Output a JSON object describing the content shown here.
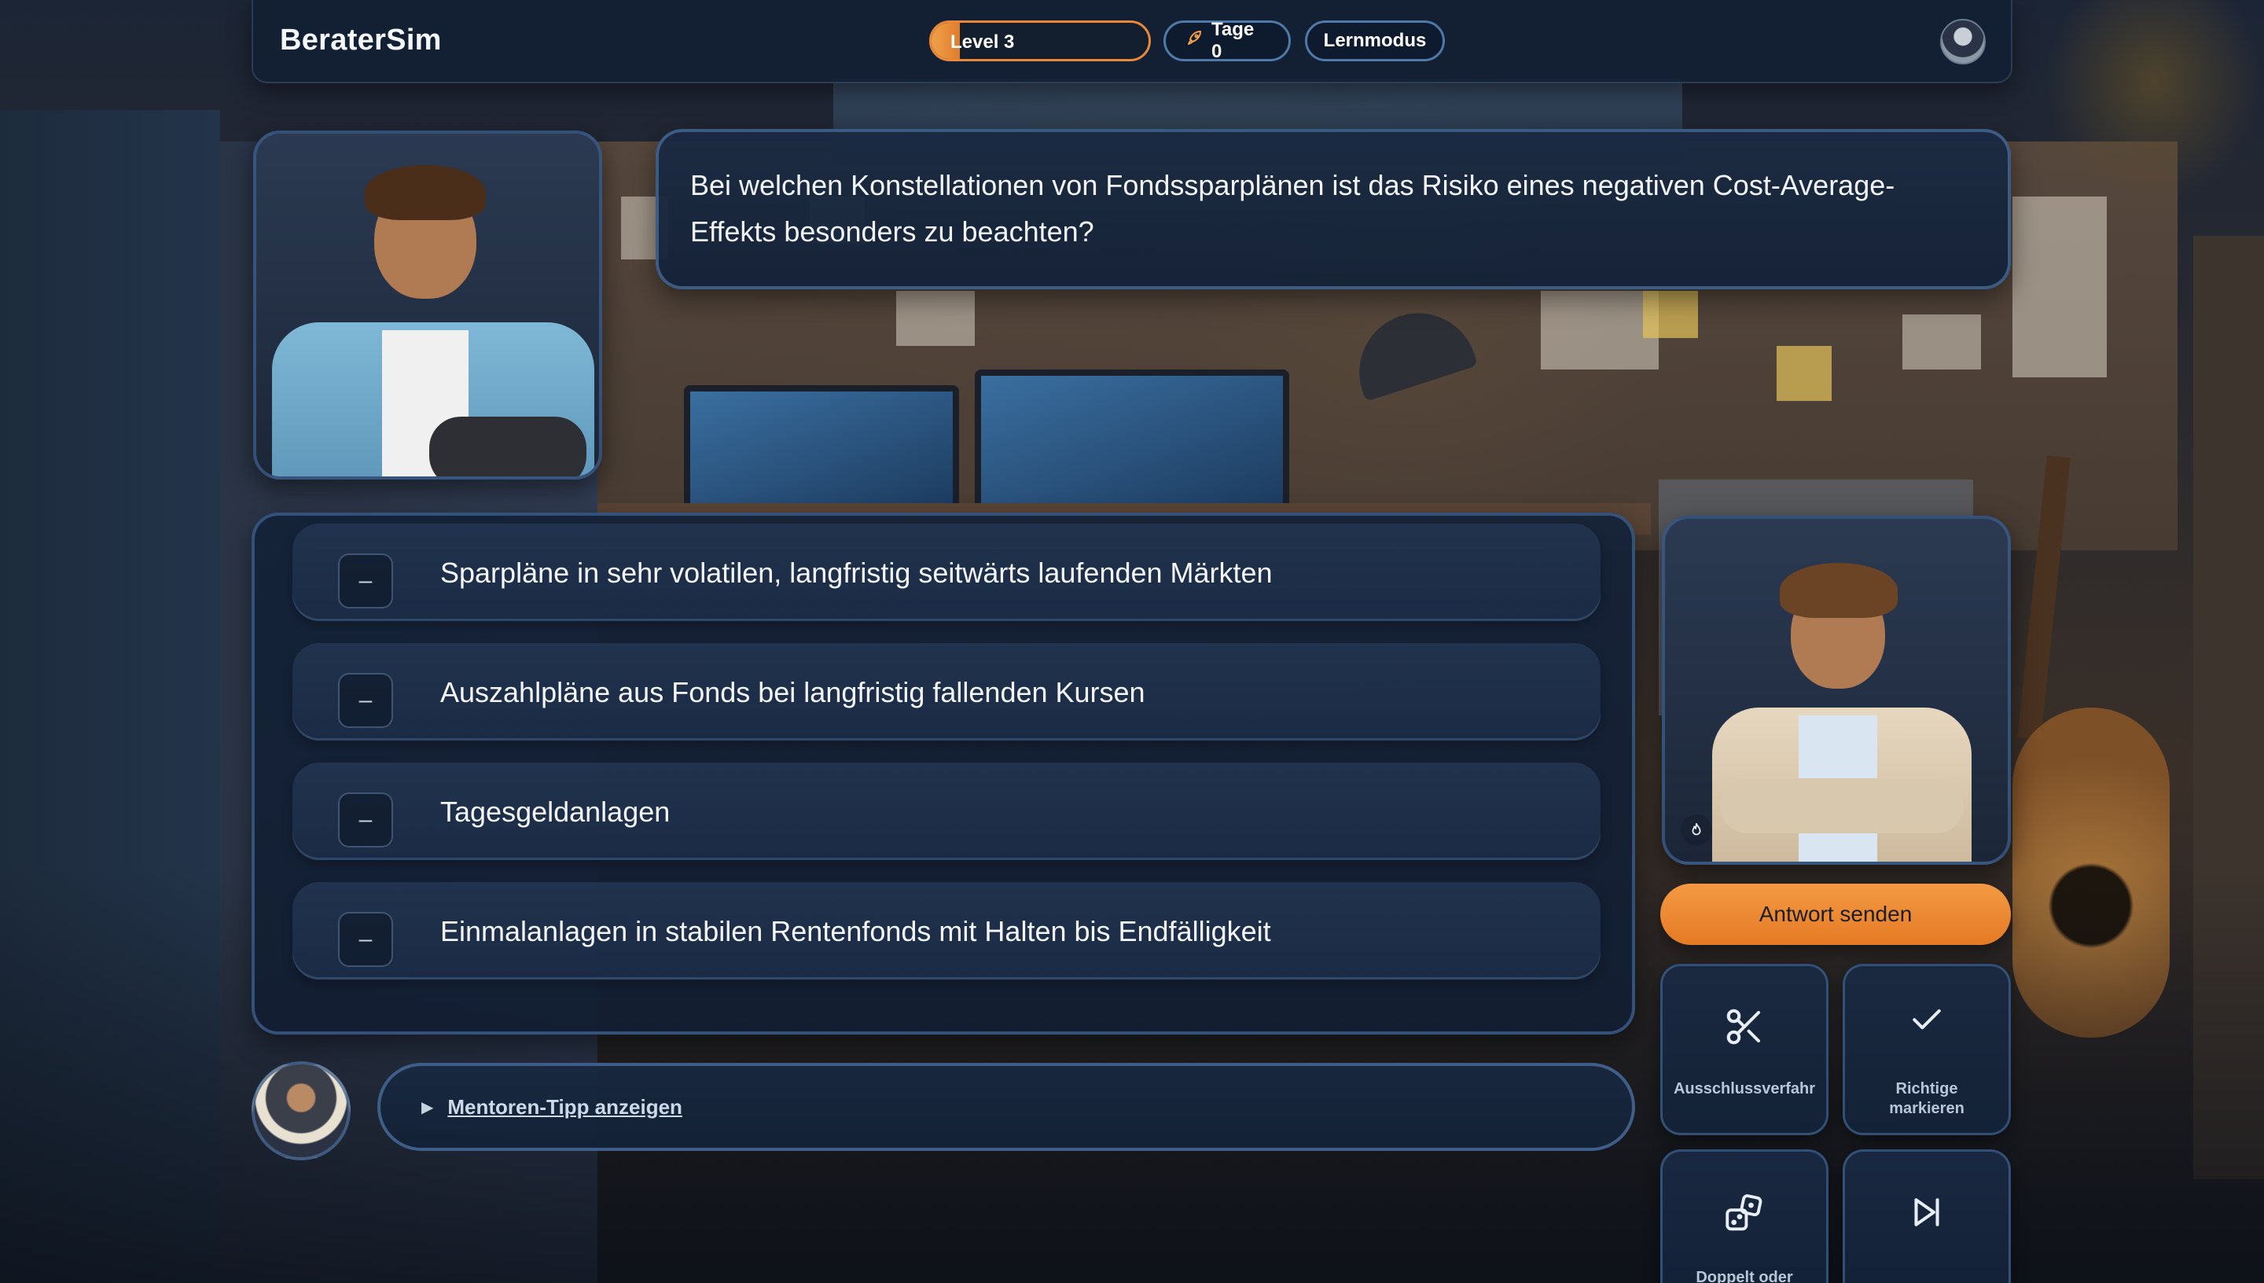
{
  "app": {
    "title": "BeraterSim"
  },
  "status": {
    "level_label": "Level 3",
    "level_progress": 0.13,
    "days_label": "Tage 0",
    "mode_label": "Lernmodus"
  },
  "question": {
    "text": "Bei welchen Konstellationen von Fondssparplänen ist das Risiko eines negativen Cost-Average-Effekts besonders zu beachten?"
  },
  "answers": [
    {
      "marker": "–",
      "text": "Sparpläne in sehr volatilen, langfristig seitwärts laufenden Märkten"
    },
    {
      "marker": "–",
      "text": "Auszahlpläne aus Fonds bei langfristig fallenden Kursen"
    },
    {
      "marker": "–",
      "text": "Tagesgeldanlagen"
    },
    {
      "marker": "–",
      "text": "Einmalanlagen in stabilen Rentenfonds mit Halten bis Endfälligkeit"
    }
  ],
  "mentor_tip": {
    "arrow": "▶",
    "label": "Mentoren-Tipp anzeigen"
  },
  "actions": {
    "send_label": "Antwort senden",
    "jokers": [
      {
        "icon": "scissors-icon",
        "label": "Ausschlussverfahr"
      },
      {
        "icon": "check-icon",
        "label_line1": "Richtige",
        "label_line2": "markieren"
      },
      {
        "icon": "dice-icon",
        "label": "Doppelt oder"
      },
      {
        "icon": "skip-forward-icon",
        "label": ""
      }
    ]
  },
  "colors": {
    "accent": "#e57a24",
    "panel": "#14223a",
    "border": "#3c5f8c"
  }
}
